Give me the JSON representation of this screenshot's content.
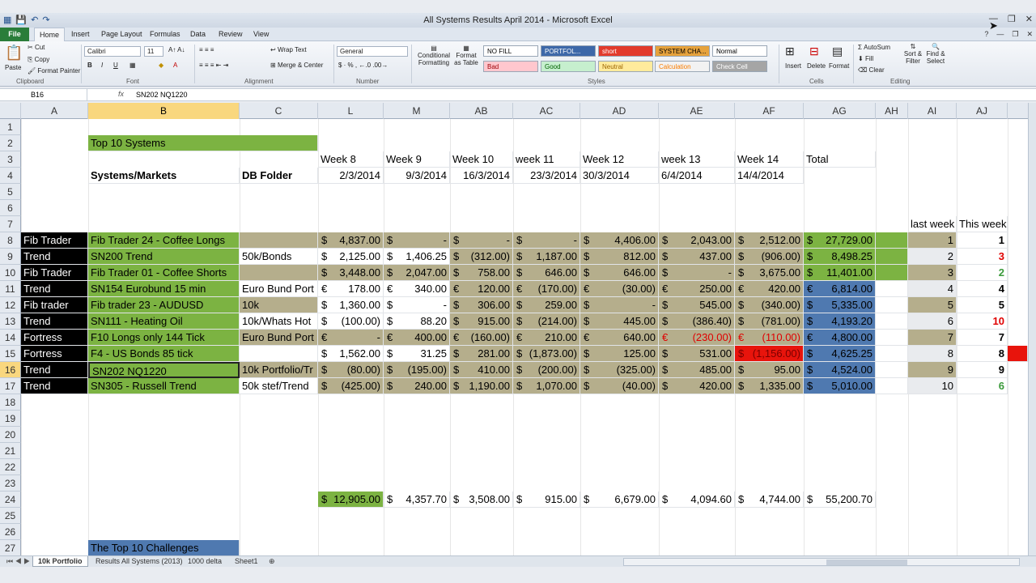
{
  "window": {
    "title": "All Systems Results April 2014 - Microsoft Excel",
    "qat_icons": [
      "excel-icon",
      "save-icon",
      "undo-icon",
      "redo-icon"
    ]
  },
  "tabs": [
    {
      "label": "File"
    },
    {
      "label": "Home"
    },
    {
      "label": "Insert"
    },
    {
      "label": "Page Layout"
    },
    {
      "label": "Formulas"
    },
    {
      "label": "Data"
    },
    {
      "label": "Review"
    },
    {
      "label": "View"
    }
  ],
  "ribbon": {
    "paste": "Paste",
    "cut": "Cut",
    "copy": "Copy",
    "format_painter": "Format Painter",
    "clipboard": "Clipboard",
    "font_name": "Calibri",
    "font_size": "11",
    "font_group": "Font",
    "bold": "B",
    "italic": "I",
    "underline": "U",
    "wrap_text": "Wrap Text",
    "merge_center": "Merge & Center",
    "alignment_group": "Alignment",
    "number_format": "General",
    "number_group": "Number",
    "cond_format": "Conditional Formatting",
    "format_table": "Format as Table",
    "styles": [
      {
        "label": "NO FILL",
        "bg": "#ffffff",
        "fg": "#000000"
      },
      {
        "label": "PORTFOL...",
        "bg": "#3d68a8",
        "fg": "#ffffff"
      },
      {
        "label": "short",
        "bg": "#e23b2c",
        "fg": "#ffffff"
      },
      {
        "label": "SYSTEM CHA...",
        "bg": "#e6a23c",
        "fg": "#000000"
      },
      {
        "label": "Normal",
        "bg": "#ffffff",
        "fg": "#000000"
      },
      {
        "label": "Bad",
        "bg": "#ffc7ce",
        "fg": "#9c0006"
      },
      {
        "label": "Good",
        "bg": "#c6efce",
        "fg": "#006100"
      },
      {
        "label": "Neutral",
        "bg": "#ffeb9c",
        "fg": "#9c6500"
      },
      {
        "label": "Calculation",
        "bg": "#f2f2f2",
        "fg": "#fa7d00"
      },
      {
        "label": "Check Cell",
        "bg": "#a5a5a5",
        "fg": "#ffffff"
      }
    ],
    "styles_group": "Styles",
    "insert": "Insert",
    "delete": "Delete",
    "format": "Format",
    "cells_group": "Cells",
    "autosum": "AutoSum",
    "fill": "Fill",
    "clear": "Clear",
    "sort_filter": "Sort & Filter",
    "find_select": "Find & Select",
    "editing_group": "Editing"
  },
  "formula_bar": {
    "name_box": "B16",
    "fx": "fx",
    "value": "SN202 NQ1220"
  },
  "columns": [
    "A",
    "B",
    "C",
    "L",
    "M",
    "AB",
    "AC",
    "AD",
    "AE",
    "AF",
    "AG",
    "AH",
    "AI",
    "AJ"
  ],
  "selected_column": "B",
  "row_numbers": [
    "1",
    "2",
    "3",
    "4",
    "5",
    "6",
    "7",
    "8",
    "9",
    "10",
    "11",
    "12",
    "13",
    "14",
    "15",
    "16",
    "17",
    "18",
    "19",
    "20",
    "21",
    "22",
    "23",
    "24",
    "25",
    "26",
    "27"
  ],
  "selected_row": "16",
  "headers": {
    "top10": "Top 10 Systems",
    "systems_markets": "Systems/Markets",
    "db_folder": "DB Folder",
    "weeks": [
      "Week 8",
      "Week 9",
      "Week 10",
      "week 11",
      "Week 12",
      "week 13",
      "Week 14",
      "Total"
    ],
    "dates": [
      "2/3/2014",
      "9/3/2014",
      "16/3/2014",
      "23/3/2014",
      "30/3/2014",
      "6/4/2014",
      "14/4/2014"
    ],
    "last_week": "last week",
    "this_week": "This week",
    "challenges": "The Top 10 Challenges"
  },
  "rows": [
    {
      "a": "Fib Trader",
      "b": "Fib Trader 24 - Coffee Longs",
      "c": "",
      "cur": "$",
      "vals": [
        "4,837.00",
        "-",
        "-",
        "-",
        "4,406.00",
        "2,043.00",
        "2,512.00"
      ],
      "total": "27,729.00",
      "tcur": "$",
      "tbg": "green",
      "last": "1",
      "now": "1",
      "nowColor": "#000000",
      "shade": true
    },
    {
      "a": "Trend",
      "b": "SN200 Trend",
      "c": "50k/Bonds",
      "cur": "$",
      "vals": [
        "2,125.00",
        "1,406.25",
        "(312.00)",
        "1,187.00",
        "812.00",
        "437.00",
        "(906.00)"
      ],
      "total": "8,498.25",
      "tcur": "$",
      "tbg": "green",
      "last": "2",
      "now": "3",
      "nowColor": "#e00000",
      "shade": false
    },
    {
      "a": "Fib Trader",
      "b": "Fib Trader 01 - Coffee Shorts",
      "c": "",
      "cur": "$",
      "vals": [
        "3,448.00",
        "2,047.00",
        "758.00",
        "646.00",
        "646.00",
        "-",
        "3,675.00"
      ],
      "total": "11,401.00",
      "tcur": "$",
      "tbg": "green",
      "last": "3",
      "now": "2",
      "nowColor": "#3a9a3a",
      "shade": true
    },
    {
      "a": "Trend",
      "b": "SN154 Eurobund 15 min",
      "c": "Euro Bund Port",
      "cur": "€",
      "vals": [
        "178.00",
        "340.00",
        "120.00",
        "(170.00)",
        "(30.00)",
        "250.00",
        "420.00"
      ],
      "total": "6,814.00",
      "tcur": "€",
      "tbg": "blue",
      "last": "4",
      "now": "4",
      "nowColor": "#000000",
      "shade": false
    },
    {
      "a": "Fib trader",
      "b": "Fib trader 23 - AUDUSD",
      "c": "10k",
      "cur": "$",
      "vals": [
        "1,360.00",
        "-",
        "306.00",
        "259.00",
        "-",
        "545.00",
        "(340.00)"
      ],
      "total": "5,335.00",
      "tcur": "$",
      "tbg": "blue",
      "last": "5",
      "now": "5",
      "nowColor": "#000000",
      "shade": true
    },
    {
      "a": "Trend",
      "b": "SN111 - Heating Oil",
      "c": "10k/Whats Hot",
      "cur": "$",
      "vals": [
        "(100.00)",
        "88.20",
        "915.00",
        "(214.00)",
        "445.00",
        "(386.40)",
        "(781.00)"
      ],
      "total": "4,193.20",
      "tcur": "$",
      "tbg": "blue",
      "last": "6",
      "now": "10",
      "nowColor": "#e00000",
      "shade": false
    },
    {
      "a": "Fortress",
      "b": "F10 Longs only 144 Tick",
      "c": "Euro Bund Port",
      "cur": "€",
      "vals": [
        "-",
        "400.00",
        "(160.00)",
        "210.00",
        "640.00",
        "(230.00)",
        "(110.00)"
      ],
      "total": "4,800.00",
      "tcur": "€",
      "tbg": "blue",
      "last": "7",
      "now": "7",
      "nowColor": "#000000",
      "shade": true
    },
    {
      "a": "Fortress",
      "b": "F4 - US Bonds 85 tick",
      "c": "",
      "cur": "$",
      "vals": [
        "1,562.00",
        "31.25",
        "281.00",
        "(1,873.00)",
        "125.00",
        "531.00",
        "(1,156.00)"
      ],
      "total": "4,625.25",
      "tcur": "$",
      "tbg": "blue",
      "last": "8",
      "now": "8",
      "nowColor": "#000000",
      "shade": false
    },
    {
      "a": "Trend",
      "b": "SN202 NQ1220",
      "c": "10k Portfolio/Tr",
      "cur": "$",
      "vals": [
        "(80.00)",
        "(195.00)",
        "410.00",
        "(200.00)",
        "(325.00)",
        "485.00",
        "95.00"
      ],
      "total": "4,524.00",
      "tcur": "$",
      "tbg": "blue",
      "last": "9",
      "now": "9",
      "nowColor": "#000000",
      "shade": true
    },
    {
      "a": "Trend",
      "b": "SN305 - Russell Trend",
      "c": "50k stef/Trend",
      "cur": "$",
      "vals": [
        "(425.00)",
        "240.00",
        "1,190.00",
        "1,070.00",
        "(40.00)",
        "420.00",
        "1,335.00"
      ],
      "total": "5,010.00",
      "tcur": "$",
      "tbg": "blue",
      "last": "10",
      "now": "6",
      "nowColor": "#3a9a3a",
      "shade": false
    }
  ],
  "totals": {
    "cur": "$",
    "vals": [
      "12,905.00",
      "4,357.70",
      "3,508.00",
      "915.00",
      "6,679.00",
      "4,094.60",
      "4,744.00"
    ],
    "grand": "55,200.70"
  },
  "sheets": [
    "10k Portfolio",
    "Results All Systems (2013)",
    "1000 delta",
    "Sheet1"
  ],
  "colors": {
    "black": "#000000",
    "green": "#7cb342",
    "tan": "#b5ae8c",
    "blue": "#4f79b0",
    "red": "#e8140c",
    "lightGray": "#e9ebee",
    "selHeader": "#f9d77e"
  }
}
